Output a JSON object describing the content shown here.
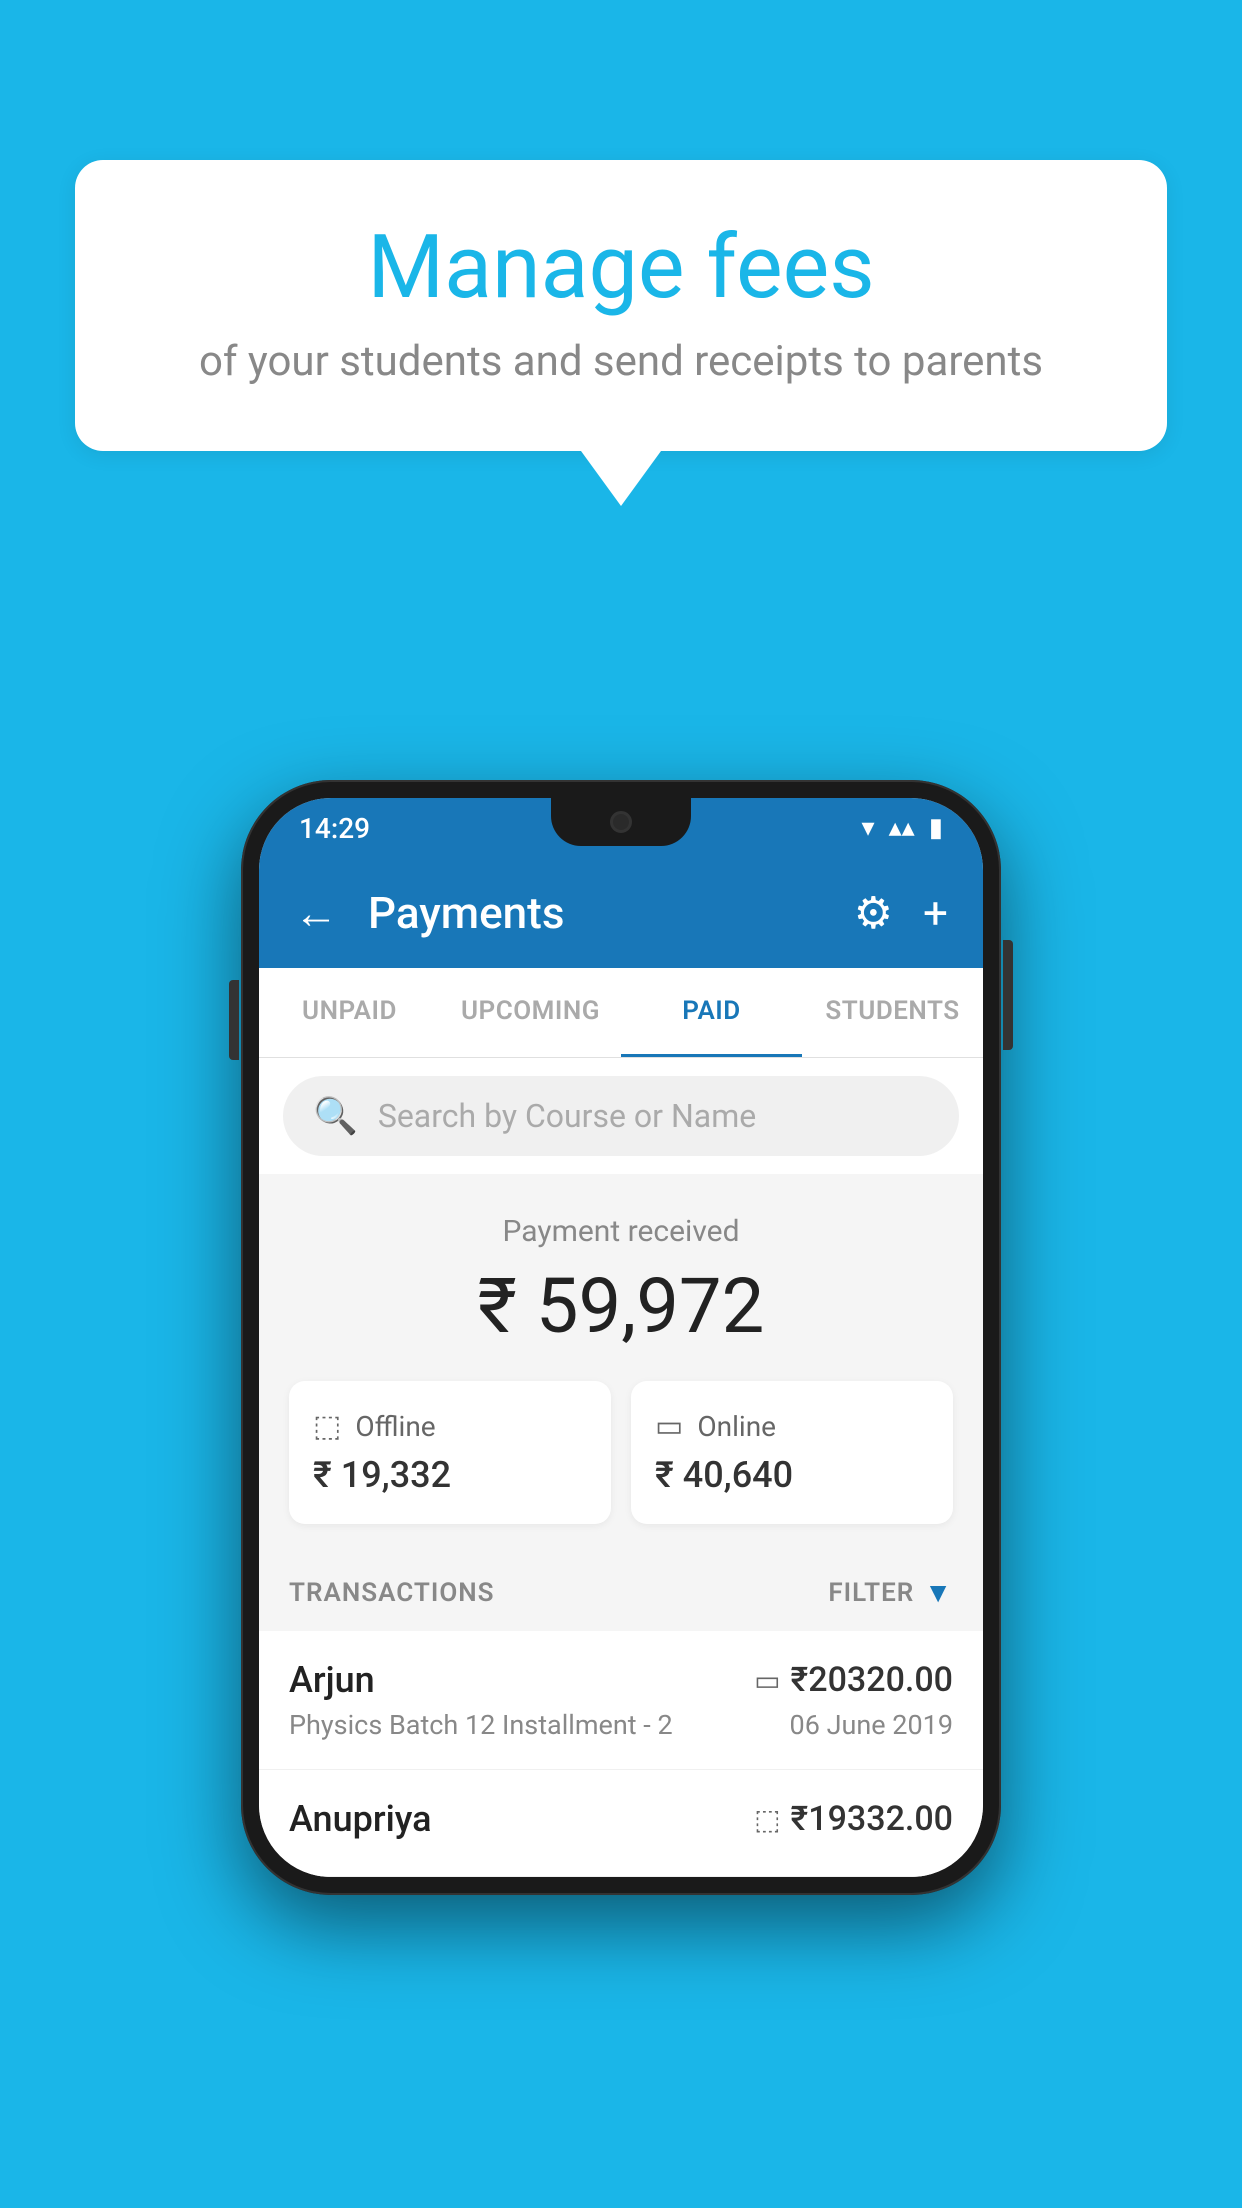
{
  "background_color": "#1ab6e8",
  "speech_bubble": {
    "title": "Manage fees",
    "subtitle": "of your students and send receipts to parents"
  },
  "phone": {
    "status_bar": {
      "time": "14:29",
      "wifi_icon": "▼",
      "signal_icon": "▲",
      "battery_icon": "▮"
    },
    "app_bar": {
      "back_label": "←",
      "title": "Payments",
      "settings_label": "⚙",
      "add_label": "+"
    },
    "tabs": [
      {
        "label": "UNPAID",
        "active": false
      },
      {
        "label": "UPCOMING",
        "active": false
      },
      {
        "label": "PAID",
        "active": true
      },
      {
        "label": "STUDENTS",
        "active": false
      }
    ],
    "search": {
      "placeholder": "Search by Course or Name"
    },
    "payment_summary": {
      "received_label": "Payment received",
      "total_amount": "₹ 59,972",
      "offline": {
        "label": "Offline",
        "amount": "₹ 19,332"
      },
      "online": {
        "label": "Online",
        "amount": "₹ 40,640"
      }
    },
    "transactions": {
      "header_label": "TRANSACTIONS",
      "filter_label": "FILTER",
      "items": [
        {
          "name": "Arjun",
          "amount": "₹20320.00",
          "payment_type": "card",
          "course": "Physics Batch 12 Installment - 2",
          "date": "06 June 2019"
        },
        {
          "name": "Anupriya",
          "amount": "₹19332.00",
          "payment_type": "offline",
          "course": "",
          "date": ""
        }
      ]
    }
  }
}
